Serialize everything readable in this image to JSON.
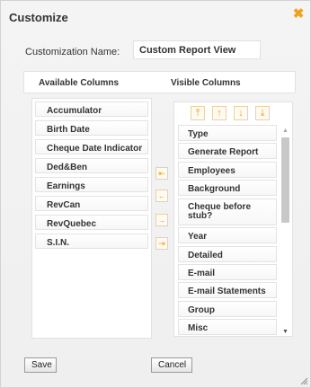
{
  "dialog": {
    "title": "Customize",
    "close_symbol": "✖"
  },
  "name_field": {
    "label": "Customization Name:",
    "value": "Custom Report View"
  },
  "headers": {
    "available": "Available Columns",
    "visible": "Visible Columns"
  },
  "available_columns": [
    "Accumulator",
    "Birth Date",
    "Cheque Date Indicator",
    "Ded&Ben",
    "Earnings",
    "RevCan",
    "RevQuebec",
    "S.I.N."
  ],
  "visible_columns": [
    "Type",
    "Generate Report",
    "Employees",
    "Background",
    "Cheque before stub?",
    "Year",
    "Detailed",
    "E-mail",
    "E-mail Statements",
    "Group",
    "Misc"
  ],
  "sort_buttons": {
    "top": "⤒",
    "up": "↑",
    "down": "↓",
    "bottom": "⤓"
  },
  "move_buttons": {
    "remove_all": "⇤",
    "remove": "←",
    "add": "→",
    "add_all": "⇥"
  },
  "buttons": {
    "save": "Save",
    "cancel": "Cancel"
  },
  "colors": {
    "accent": "#f0a21e",
    "border": "#e2e2e2",
    "background": "#f2f2f2"
  },
  "icons": {
    "close": "close-icon",
    "move_top": "arrow-to-top-icon",
    "move_up": "arrow-up-icon",
    "move_down": "arrow-down-icon",
    "move_bottom": "arrow-to-bottom-icon",
    "remove_all": "arrow-left-bar-icon",
    "remove": "arrow-left-icon",
    "add": "arrow-right-icon",
    "add_all": "arrow-right-bar-icon"
  }
}
